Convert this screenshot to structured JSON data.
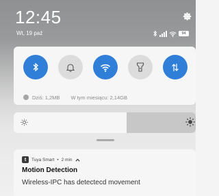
{
  "status_bar": {
    "time": "12:45",
    "date": "Wt, 19 paź",
    "battery": "94",
    "icons": [
      "bluetooth-icon",
      "signal-icon",
      "wifi-icon",
      "battery-icon"
    ]
  },
  "quick_settings": {
    "toggles": [
      {
        "name": "bluetooth",
        "icon": "bluetooth-icon",
        "state": "on"
      },
      {
        "name": "sound",
        "icon": "bell-icon",
        "state": "off"
      },
      {
        "name": "wifi",
        "icon": "wifi-icon",
        "state": "on"
      },
      {
        "name": "flashlight",
        "icon": "flashlight-icon",
        "state": "off"
      },
      {
        "name": "mobile-data",
        "icon": "data-arrows-icon",
        "state": "on"
      }
    ],
    "data_usage": {
      "today": "Dziś: 1,2MB",
      "month": "W tym miesiącu: 2,14GB"
    }
  },
  "brightness": {
    "level": 0.62
  },
  "notification": {
    "app": "Tuya Smart",
    "time": "2 min",
    "title": "Motion Detection",
    "body": "Wireless-IPC has detectecd movement"
  },
  "colors": {
    "accent": "#2f7ed8",
    "toggle_off": "#dcdcdc"
  }
}
